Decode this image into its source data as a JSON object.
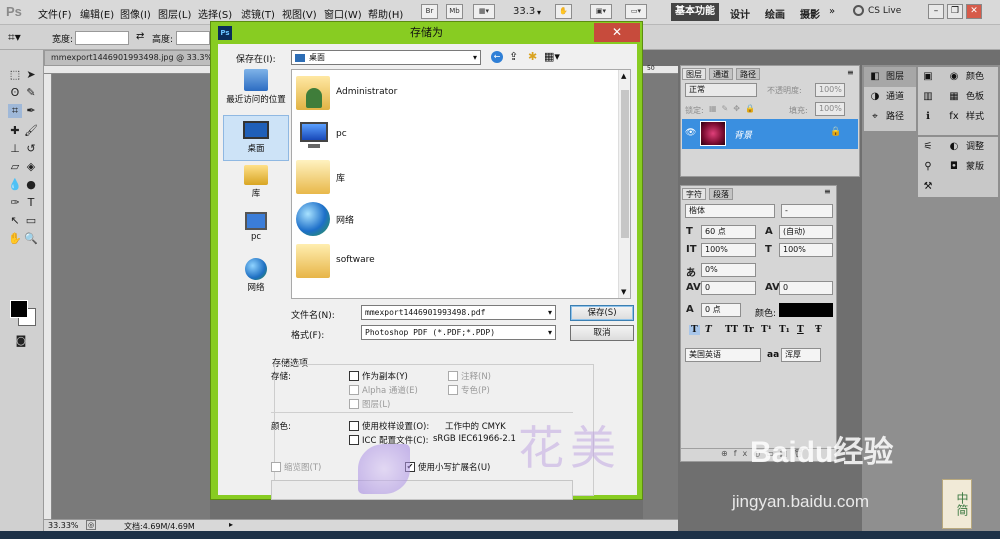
{
  "app": {
    "logo": "Ps"
  },
  "menubar": {
    "items": [
      "文件(F)",
      "编辑(E)",
      "图像(I)",
      "图层(L)",
      "选择(S)",
      "滤镜(T)",
      "视图(V)",
      "窗口(W)",
      "帮助(H)"
    ],
    "zoom": "33.3",
    "bridge_label": "Br",
    "mini_bridge_label": "Mb",
    "workspaces": {
      "active": "基本功能",
      "others": [
        "设计",
        "绘画",
        "摄影"
      ]
    },
    "cs_live": "CS Live"
  },
  "optionsbar": {
    "width_label": "宽度:",
    "height_label": "高度:"
  },
  "document": {
    "tab_title": "mmexport1446901993498.jpg @ 33.3%",
    "ruler_mark": "50"
  },
  "statusbar": {
    "zoom": "33.33%",
    "doc_info": "文档:4.69M/4.69M"
  },
  "layers_panel": {
    "tabs": [
      "图层",
      "通道",
      "路径"
    ],
    "blend_mode": "正常",
    "opacity_label": "不透明度:",
    "opacity_value": "100%",
    "lock_label": "锁定:",
    "fill_label": "填充:",
    "fill_value": "100%",
    "layer_name": "背景"
  },
  "character_panel": {
    "tabs": [
      "字符",
      "段落"
    ],
    "font_family": "楷体",
    "font_style": "-",
    "font_size": "60 点",
    "leading": "(自动)",
    "vertical_scale": "100%",
    "horizontal_scale": "100%",
    "tsume": "0%",
    "kerning": "0",
    "tracking": "0",
    "baseline_shift": "0 点",
    "color_label": "颜色:",
    "style_buttons": [
      "T",
      "T",
      "TT",
      "Tr",
      "T¹",
      "T₁",
      "T",
      "Ŧ"
    ],
    "language": "美国英语",
    "anti_alias_label": "aa",
    "anti_alias": "浑厚"
  },
  "dock": {
    "col1": [
      "图层",
      "通道",
      "路径"
    ],
    "col2": [
      "颜色",
      "色板",
      "样式",
      "调整",
      "蒙版"
    ]
  },
  "dialog": {
    "title": "存储为",
    "save_in_label": "保存在(I):",
    "save_in_value": "桌面",
    "places": [
      "最近访问的位置",
      "桌面",
      "库",
      "pc",
      "网络"
    ],
    "files": [
      "Administrator",
      "pc",
      "库",
      "网络",
      "software"
    ],
    "filename_label": "文件名(N):",
    "filename_value": "mmexport1446901993498.pdf",
    "format_label": "格式(F):",
    "format_value": "Photoshop PDF (*.PDF;*.PDP)",
    "save_button": "保存(S)",
    "cancel_button": "取消",
    "options": {
      "group_title": "存储选项",
      "save_label": "存储:",
      "as_copy": "作为副本(Y)",
      "annotations": "注释(N)",
      "alpha_channels": "Alpha 通道(E)",
      "spot_colors": "专色(P)",
      "layers": "图层(L)",
      "color_label": "颜色:",
      "use_proof": "使用校样设置(O):",
      "proof_value": "工作中的 CMYK",
      "icc_profile": "ICC 配置文件(C):",
      "icc_value": "sRGB IEC61966-2.1",
      "thumbnail": "缩览图(T)",
      "lowercase_ext": "使用小写扩展名(U)"
    }
  },
  "watermark": {
    "baidu": "Baidu经验",
    "url": "jingyan.baidu.com",
    "flower_text": "花美"
  }
}
